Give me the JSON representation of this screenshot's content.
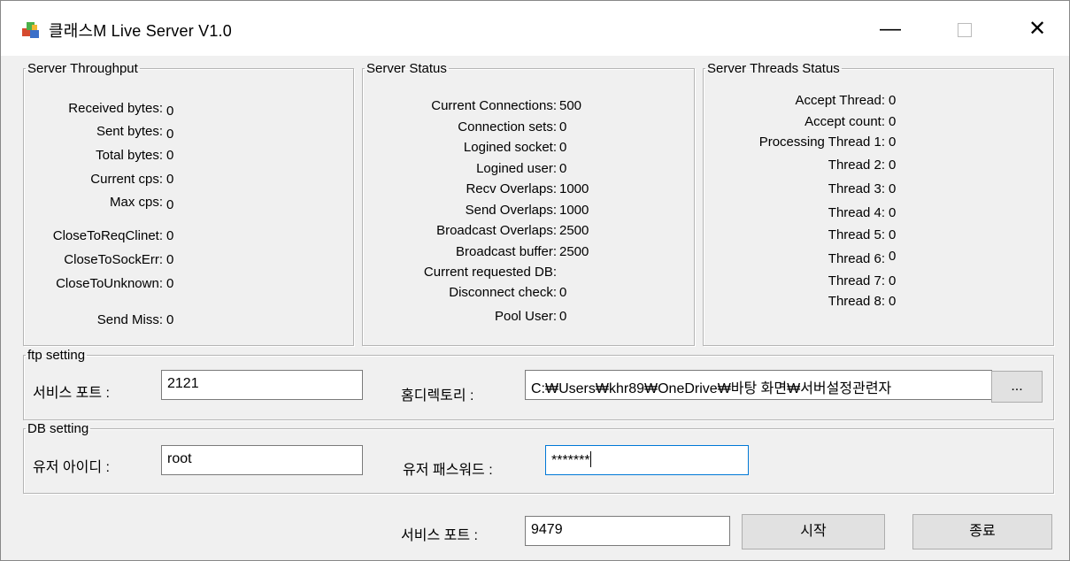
{
  "window": {
    "title": "클래스M Live Server V1.0",
    "minimize_glyph": "—",
    "close_glyph": "✕"
  },
  "throughput": {
    "legend": "Server Throughput",
    "items": [
      {
        "label": "Received bytes:",
        "value": "0"
      },
      {
        "label": "Sent bytes:",
        "value": "0"
      },
      {
        "label": "Total bytes:",
        "value": "0"
      },
      {
        "label": "Current cps:",
        "value": "0"
      },
      {
        "label": "Max cps:",
        "value": "0"
      },
      {
        "label": "CloseToReqClinet:",
        "value": "0"
      },
      {
        "label": "CloseToSockErr:",
        "value": "0"
      },
      {
        "label": "CloseToUnknown:",
        "value": "0"
      },
      {
        "label": "Send Miss:",
        "value": "0"
      }
    ]
  },
  "status": {
    "legend": "Server Status",
    "items": [
      {
        "label": "Current Connections:",
        "value": "500"
      },
      {
        "label": "Connection sets:",
        "value": "0"
      },
      {
        "label": "Logined socket:",
        "value": "0"
      },
      {
        "label": "Logined user:",
        "value": "0"
      },
      {
        "label": "Recv Overlaps:",
        "value": "1000"
      },
      {
        "label": "Send Overlaps:",
        "value": "1000"
      },
      {
        "label": "Broadcast Overlaps:",
        "value": "2500"
      },
      {
        "label": "Broadcast buffer:",
        "value": "2500"
      },
      {
        "label": "Current requested DB:",
        "value": ""
      },
      {
        "label": "Disconnect check:",
        "value": "0"
      },
      {
        "label": "Pool User:",
        "value": "0"
      }
    ]
  },
  "threads": {
    "legend": "Server Threads Status",
    "items": [
      {
        "label": "Accept Thread:",
        "value": "0"
      },
      {
        "label": "Accept count:",
        "value": "0"
      },
      {
        "label": "Processing Thread 1:",
        "value": "0"
      },
      {
        "label": "Thread 2:",
        "value": "0"
      },
      {
        "label": "Thread 3:",
        "value": "0"
      },
      {
        "label": "Thread 4:",
        "value": "0"
      },
      {
        "label": "Thread 5:",
        "value": "0"
      },
      {
        "label": "Thread 6:",
        "value": "0"
      },
      {
        "label": "Thread 7:",
        "value": "0"
      },
      {
        "label": "Thread 8:",
        "value": "0"
      }
    ]
  },
  "ftp": {
    "legend": "ftp setting",
    "port_label": "서비스 포트 :",
    "port_value": "2121",
    "home_label": "홈디렉토리 :",
    "home_value": "C:₩Users₩khr89₩OneDrive₩바탕 화면₩서버설정관련자",
    "browse_label": "..."
  },
  "db": {
    "legend": "DB setting",
    "user_label": "유저 아이디 :",
    "user_value": "root",
    "pass_label": "유저 패스워드 :",
    "pass_value": "*******"
  },
  "footer": {
    "port_label": "서비스 포트 :",
    "port_value": "9479",
    "start_label": "시작",
    "exit_label": "종료"
  }
}
